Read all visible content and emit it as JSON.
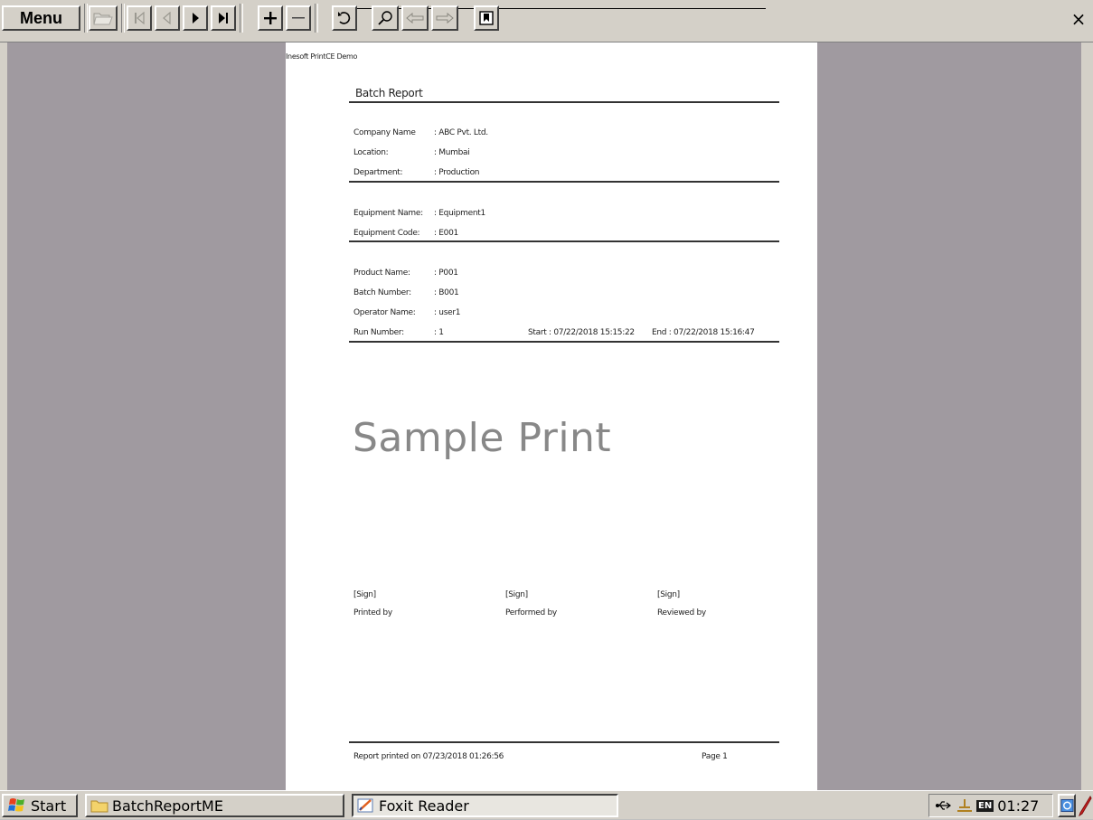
{
  "toolbar": {
    "menu_label": "Menu",
    "buttons": [
      "open-icon",
      "first-page-icon",
      "previous-page-icon",
      "next-page-icon",
      "last-page-icon",
      "zoom-in-icon",
      "zoom-out-icon",
      "rotate-icon",
      "find-icon",
      "back-icon",
      "forward-icon",
      "bookmark-icon"
    ],
    "close_label": "×"
  },
  "document": {
    "header": "Inesoft PrintCE Demo",
    "title": "Batch Report",
    "company": {
      "rows": [
        {
          "label": "Company Name",
          "value": ": ABC Pvt. Ltd."
        },
        {
          "label": "Location:",
          "value": ": Mumbai"
        },
        {
          "label": "Department:",
          "value": ": Production"
        }
      ]
    },
    "equipment": {
      "rows": [
        {
          "label": "Equipment Name:",
          "value": ": Equipment1"
        },
        {
          "label": "Equipment Code:",
          "value": ": E001"
        }
      ]
    },
    "batch": {
      "rows": [
        {
          "label": "Product Name:",
          "value": ": P001"
        },
        {
          "label": "Batch Number:",
          "value": ": B001"
        },
        {
          "label": "Operator Name:",
          "value": ": user1"
        },
        {
          "label": "Run Number:",
          "value": ": 1"
        }
      ],
      "start": "Start : 07/22/2018 15:15:22",
      "end": "End : 07/22/2018 15:16:47"
    },
    "watermark": "Sample Print",
    "signatures": [
      {
        "sign": "[Sign]",
        "role": "Printed by"
      },
      {
        "sign": "[Sign]",
        "role": "Performed by"
      },
      {
        "sign": "[Sign]",
        "role": "Reviewed by"
      }
    ],
    "footer": {
      "printed_on": "Report printed on 07/23/2018 01:26:56",
      "page": "Page 1"
    }
  },
  "taskbar": {
    "start_label": "Start",
    "tasks": [
      {
        "label": "BatchReportME",
        "icon": "folder-icon"
      },
      {
        "label": "Foxit Reader",
        "icon": "foxit-icon"
      }
    ],
    "tray": {
      "language": "EN",
      "clock": "01:27"
    }
  },
  "colors": {
    "chrome": "#d4d0c8",
    "workspace": "#a09aa0",
    "paper": "#ffffff",
    "watermark": "#888888"
  }
}
